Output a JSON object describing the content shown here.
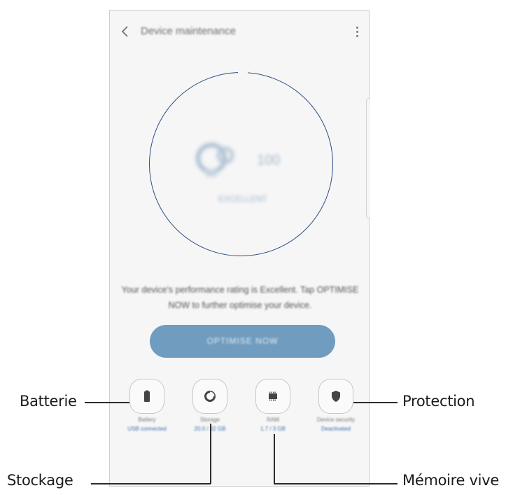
{
  "header": {
    "title": "Device maintenance",
    "back_icon": "chevron-left-icon",
    "more_icon": "more-vert-icon"
  },
  "score": {
    "value": "100",
    "status": "EXCELLENT",
    "ring_color": "#2e4e86"
  },
  "description": "Your device's performance rating is Excellent. Tap OPTIMISE NOW to further optimise your device.",
  "optimise_button": {
    "label": "OPTIMISE NOW",
    "color": "#6f9cbf"
  },
  "tools": [
    {
      "name": "Battery",
      "status": "USB connected",
      "icon": "battery-icon"
    },
    {
      "name": "Storage",
      "status": "20.0 / 32 GB",
      "icon": "storage-icon"
    },
    {
      "name": "RAM",
      "status": "1.7 / 3 GB",
      "icon": "ram-icon"
    },
    {
      "name": "Device security",
      "status": "Deactivated",
      "icon": "shield-icon"
    }
  ],
  "callouts": {
    "battery": "Batterie",
    "storage": "Stockage",
    "ram": "Mémoire vive",
    "security": "Protection"
  }
}
